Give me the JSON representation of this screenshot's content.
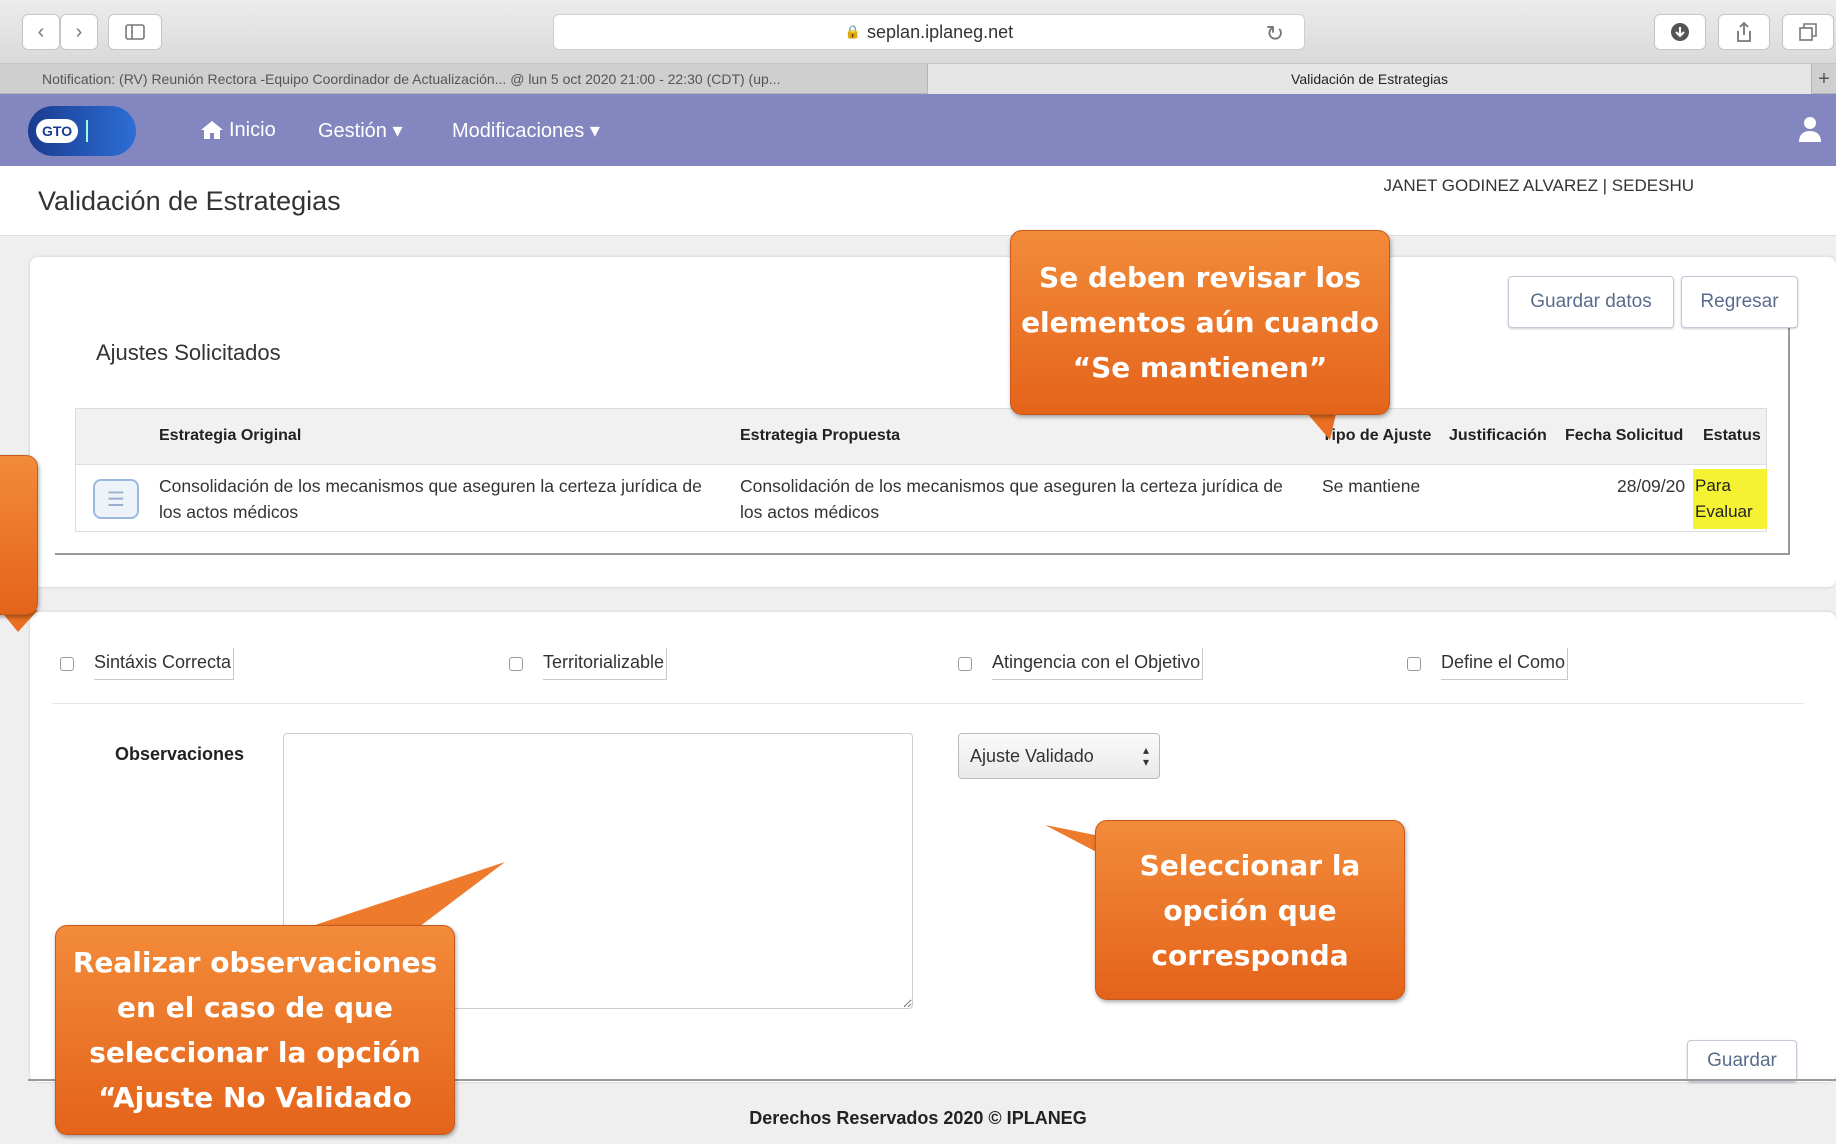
{
  "browser": {
    "url": "seplan.iplaneg.net",
    "tabs": [
      {
        "label": "Notification: (RV) Reunión Rectora -Equipo Coordinador de Actualización... @ lun 5 oct 2020 21:00 - 22:30 (CDT) (up..."
      },
      {
        "label": "Validación de Estrategias"
      }
    ],
    "new_tab_label": "+"
  },
  "nav": {
    "logo_text": "GTO",
    "items": [
      {
        "label": "Inicio",
        "icon": "home-icon"
      },
      {
        "label": "Gestión ▾"
      },
      {
        "label": "Modificaciones ▾"
      }
    ]
  },
  "page": {
    "title": "Validación de Estrategias",
    "user_line": "JANET GODINEZ ALVAREZ | SEDESHU"
  },
  "actions": {
    "save_data": "Guardar datos",
    "back": "Regresar",
    "save": "Guardar"
  },
  "adjustments": {
    "title": "Ajustes Solicitados",
    "columns": [
      "Estrategia Original",
      "Estrategia Propuesta",
      "Tipo de Ajuste",
      "Justificación",
      "Fecha Solicitud",
      "Estatus"
    ],
    "rows": [
      {
        "original": "Consolidación de los mecanismos que aseguren la certeza jurídica de los actos médicos",
        "proposed": "Consolidación de los mecanismos que aseguren la certeza jurídica de los actos médicos",
        "type": "Se mantiene",
        "justification": "",
        "date": "28/09/20",
        "status": "Para Evaluar"
      }
    ]
  },
  "criteria": {
    "items": [
      {
        "label": "Sintáxis Correcta",
        "checked": false
      },
      {
        "label": "Territorializable",
        "checked": false
      },
      {
        "label": "Atingencia con el Objetivo",
        "checked": false
      },
      {
        "label": "Define el Como",
        "checked": false
      }
    ]
  },
  "form": {
    "observations_label": "Observaciones",
    "observations_value": "",
    "select_value": "Ajuste Validado"
  },
  "footer": "Derechos Reservados 2020 © IPLANEG",
  "callouts": {
    "review": "Se deben revisar los elementos aún cuando “Se mantienen”",
    "select": "Seleccionar la opción que corresponda",
    "observations": "Realizar observaciones en el caso de que seleccionar la opción “Ajuste No Validado"
  },
  "colors": {
    "nav_bg": "#8486bf",
    "callout_orange": "#ec7426",
    "status_highlight": "#f5f233",
    "button_text": "#5a6c8c"
  }
}
